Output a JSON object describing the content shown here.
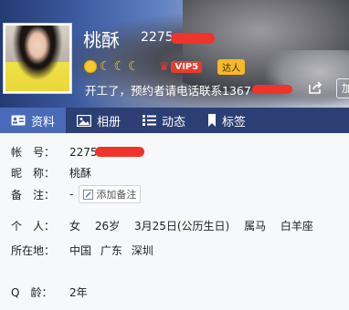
{
  "profile": {
    "name": "桃酥",
    "uid": "2275",
    "signature": "开工了，预约者请电话联系1367",
    "vip_label": "VIP5",
    "daren_label": "达人",
    "more_label": "加"
  },
  "tabs": [
    {
      "label": "资料",
      "icon": "id-card-icon"
    },
    {
      "label": "相册",
      "icon": "photo-icon"
    },
    {
      "label": "动态",
      "icon": "list-icon"
    },
    {
      "label": "标签",
      "icon": "bookmark-icon"
    }
  ],
  "info": {
    "account_label": "帐　号：",
    "account_value": "2275",
    "nickname_label": "昵　称：",
    "nickname_value": "桃酥",
    "note_label": "备　注：",
    "note_value": "-",
    "add_note_label": "添加备注",
    "personal_label": "个　人：",
    "personal": [
      "女",
      "26岁",
      "3月25日(公历生日)",
      "属马",
      "白羊座"
    ],
    "location_label": "所在地：",
    "location": [
      "中国",
      "广东",
      "深圳"
    ],
    "qage_label": "Q　龄：",
    "qage_value": "2年"
  },
  "colors": {
    "tab_bar": "#2c3f74",
    "tab_active": "#4a6ab7",
    "redaction": "#f0332b",
    "vip": "#e43d2d"
  }
}
